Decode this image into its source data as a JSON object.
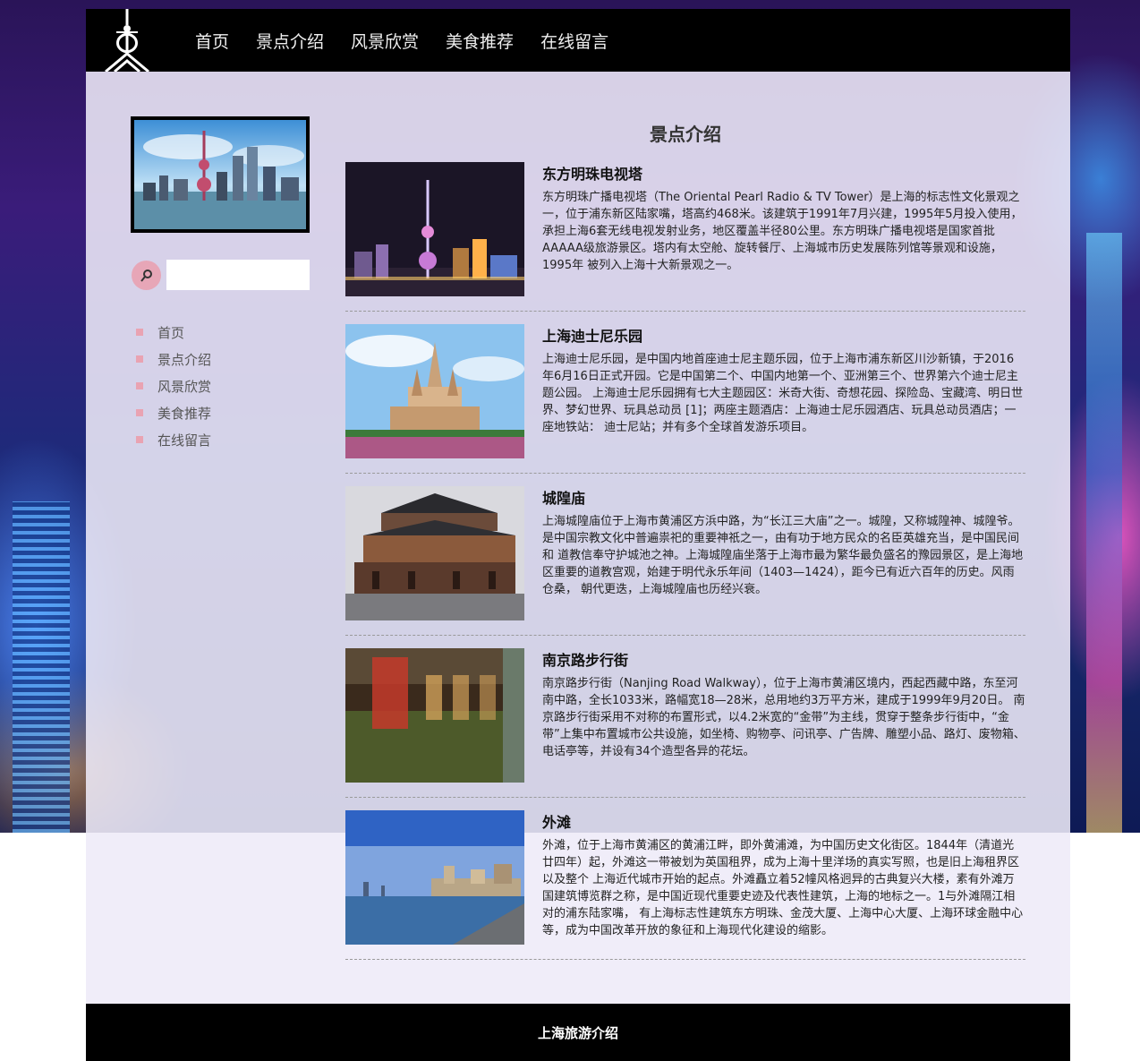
{
  "nav": {
    "items": [
      "首页",
      "景点介绍",
      "风景欣赏",
      "美食推荐",
      "在线留言"
    ]
  },
  "sidebar": {
    "search_placeholder": "",
    "menu": [
      "首页",
      "景点介绍",
      "风景欣赏",
      "美食推荐",
      "在线留言"
    ]
  },
  "main": {
    "title": "景点介绍",
    "articles": [
      {
        "title": "东方明珠电视塔",
        "desc": "东方明珠广播电视塔（The Oriental Pearl Radio & TV Tower）是上海的标志性文化景观之一，位于浦东新区陆家嘴，塔高约468米。该建筑于1991年7月兴建，1995年5月投入使用， 承担上海6套无线电视发射业务，地区覆盖半径80公里。东方明珠广播电视塔是国家首批AAAAA级旅游景区。塔内有太空舱、旋转餐厅、上海城市历史发展陈列馆等景观和设施，1995年 被列入上海十大新景观之一。"
      },
      {
        "title": "上海迪士尼乐园",
        "desc": "上海迪士尼乐园，是中国内地首座迪士尼主题乐园，位于上海市浦东新区川沙新镇，于2016年6月16日正式开园。它是中国第二个、中国内地第一个、亚洲第三个、世界第六个迪士尼主题公园。 上海迪士尼乐园拥有七大主题园区：米奇大街、奇想花园、探险岛、宝藏湾、明日世界、梦幻世界、玩具总动员 [1]；两座主题酒店：上海迪士尼乐园酒店、玩具总动员酒店；一座地铁站： 迪士尼站；并有多个全球首发游乐项目。"
      },
      {
        "title": "城隍庙",
        "desc": "上海城隍庙位于上海市黄浦区方浜中路，为“长江三大庙”之一。城隍，又称城隍神、城隍爷。是中国宗教文化中普遍祟祀的重要神祇之一，由有功于地方民众的名臣英雄充当，是中国民间和 道教信奉守护城池之神。上海城隍庙坐落于上海市最为繁华最负盛名的豫园景区，是上海地区重要的道教宫观，始建于明代永乐年间（1403—1424），距今已有近六百年的历史。风雨仓桑， 朝代更迭，上海城隍庙也历经兴衰。"
      },
      {
        "title": "南京路步行街",
        "desc": "南京路步行街（Nanjing Road Walkway），位于上海市黄浦区境内，西起西藏中路，东至河南中路，全长1033米，路幅宽18—28米，总用地约3万平方米，建成于1999年9月20日。 南京路步行街采用不对称的布置形式，以4.2米宽的“金带”为主线，贯穿于整条步行街中，“金带”上集中布置城市公共设施，如坐椅、购物亭、问讯亭、广告牌、雕塑小品、路灯、废物箱、 电话亭等，并设有34个造型各异的花坛。"
      },
      {
        "title": "外滩",
        "desc": "外滩，位于上海市黄浦区的黄浦江畔，即外黄浦滩，为中国历史文化街区。1844年（清道光廿四年）起，外滩这一带被划为英国租界，成为上海十里洋场的真实写照，也是旧上海租界区以及整个 上海近代城市开始的起点。外滩矗立着52幢风格迥异的古典复兴大楼，素有外滩万国建筑博览群之称，是中国近现代重要史迹及代表性建筑，上海的地标之一。1与外滩隔江相对的浦东陆家嘴， 有上海标志性建筑东方明珠、金茂大厦、上海中心大厦、上海环球金融中心等，成为中国改革开放的象征和上海现代化建设的缩影。"
      }
    ]
  },
  "footer": {
    "text": "上海旅游介绍"
  }
}
